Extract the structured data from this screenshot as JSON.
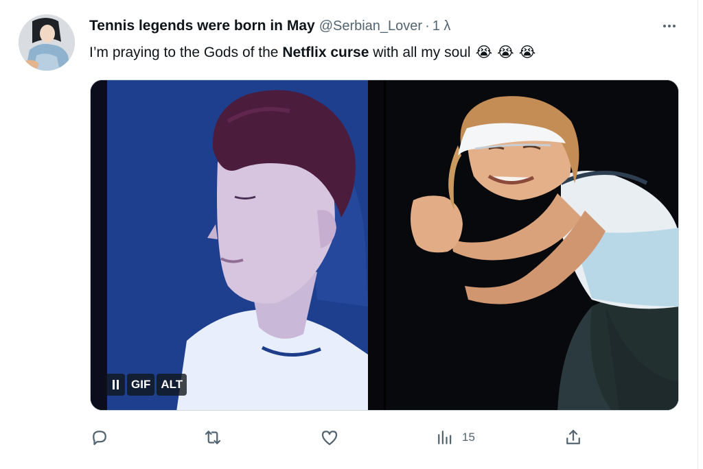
{
  "tweet": {
    "display_name": "Tennis legends were born in May",
    "handle": "@Serbian_Lover",
    "separator": "·",
    "timestamp": "1 λ",
    "more_icon": "more-horizontal-icon",
    "text": {
      "before": "I’m praying to the Gods of the ",
      "bold": "Netflix curse",
      "after": " with all my soul",
      "emojis": [
        "😭",
        "😭",
        "😭"
      ]
    }
  },
  "media": {
    "controls": {
      "pause_icon": "pause-icon",
      "gif_label": "GIF",
      "alt_label": "ALT"
    }
  },
  "actions": {
    "reply_icon": "reply-icon",
    "retweet_icon": "retweet-icon",
    "like_icon": "heart-icon",
    "views_icon": "views-bar-chart-icon",
    "views_count": "15",
    "share_icon": "share-icon"
  },
  "colors": {
    "text_primary": "#0f1419",
    "text_secondary": "#536471",
    "border": "#cfd9de",
    "overlay": "#0f1419"
  }
}
